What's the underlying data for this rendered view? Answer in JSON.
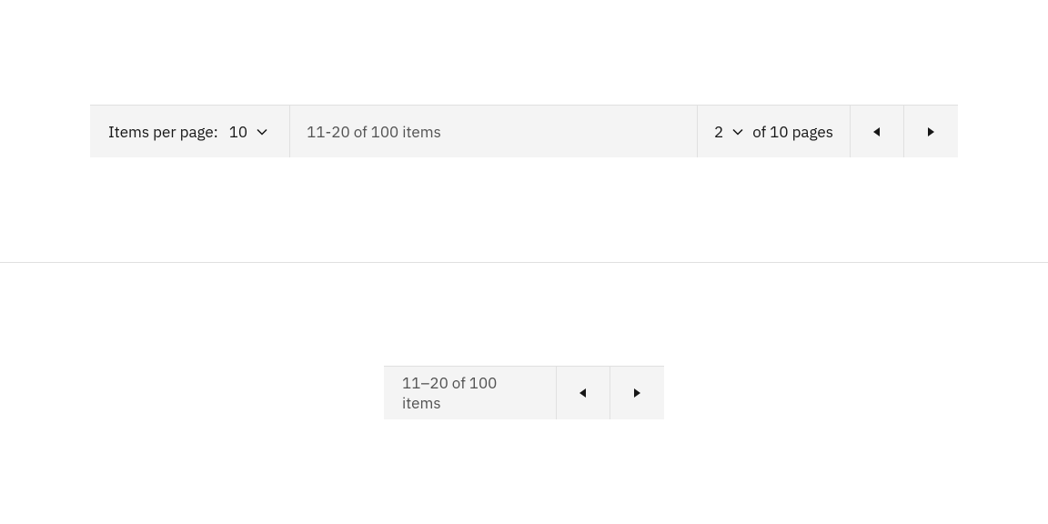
{
  "pagination_full": {
    "items_per_page_label": "Items per page:",
    "items_per_page_value": "10",
    "item_range": "11-20 of 100 items",
    "page_value": "2",
    "page_of": "of 10 pages"
  },
  "pagination_mini": {
    "item_range": "11–20 of 100 items"
  }
}
